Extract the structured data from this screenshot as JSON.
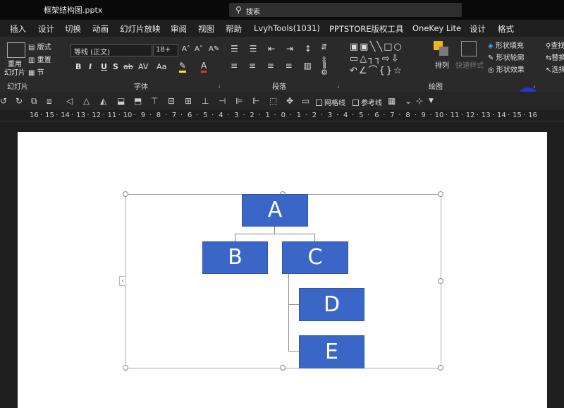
{
  "window": {
    "filename": "框架结构图.pptx",
    "search_label": "搜索"
  },
  "tabs": [
    "插入",
    "设计",
    "切换",
    "动画",
    "幻灯片放映",
    "审阅",
    "视图",
    "帮助",
    "LvyhTools(1031)",
    "PPTSTORE版权工具",
    "OneKey Lite",
    "设计",
    "格式"
  ],
  "ribbon": {
    "slides": {
      "reuse_label": "重用\n幻灯片",
      "layout_label": "版式",
      "reset_label": "重置",
      "section_label": "节",
      "group": "幻灯片"
    },
    "font": {
      "family": "等线 (正文)",
      "size": "18+",
      "bold": "B",
      "italic": "I",
      "underline": "U",
      "shadow": "S",
      "strike": "ab",
      "spacing": "AV",
      "case": "Aa",
      "group": "字体"
    },
    "paragraph": {
      "group": "段落"
    },
    "drawing": {
      "arrange_label": "排列",
      "quick_styles_label": "快速样式",
      "shape_fill": "形状填充",
      "shape_outline": "形状轮廓",
      "shape_effects": "形状效果",
      "group": "绘图"
    },
    "editing": {
      "find": "查找",
      "replace": "替换",
      "select": "选择"
    }
  },
  "quick_toolbar": {
    "gridlines": "网格线",
    "guides": "参考线"
  },
  "ruler": [
    "16",
    "15",
    "14",
    "13",
    "12",
    "11",
    "10",
    "9",
    "8",
    "7",
    "6",
    "5",
    "4",
    "3",
    "2",
    "1",
    "0",
    "1",
    "2",
    "3",
    "4",
    "5",
    "6",
    "7",
    "8",
    "9",
    "10",
    "11",
    "12",
    "13",
    "14",
    "15",
    "16"
  ],
  "diagram": {
    "nodes": [
      {
        "id": "a",
        "label": "A"
      },
      {
        "id": "b",
        "label": "B"
      },
      {
        "id": "c",
        "label": "C"
      },
      {
        "id": "d",
        "label": "D"
      },
      {
        "id": "e",
        "label": "E"
      }
    ]
  },
  "colors": {
    "node_fill": "#3a66c8",
    "connector": "#8c8c8c",
    "cursor_highlight": "#2f33c8"
  }
}
